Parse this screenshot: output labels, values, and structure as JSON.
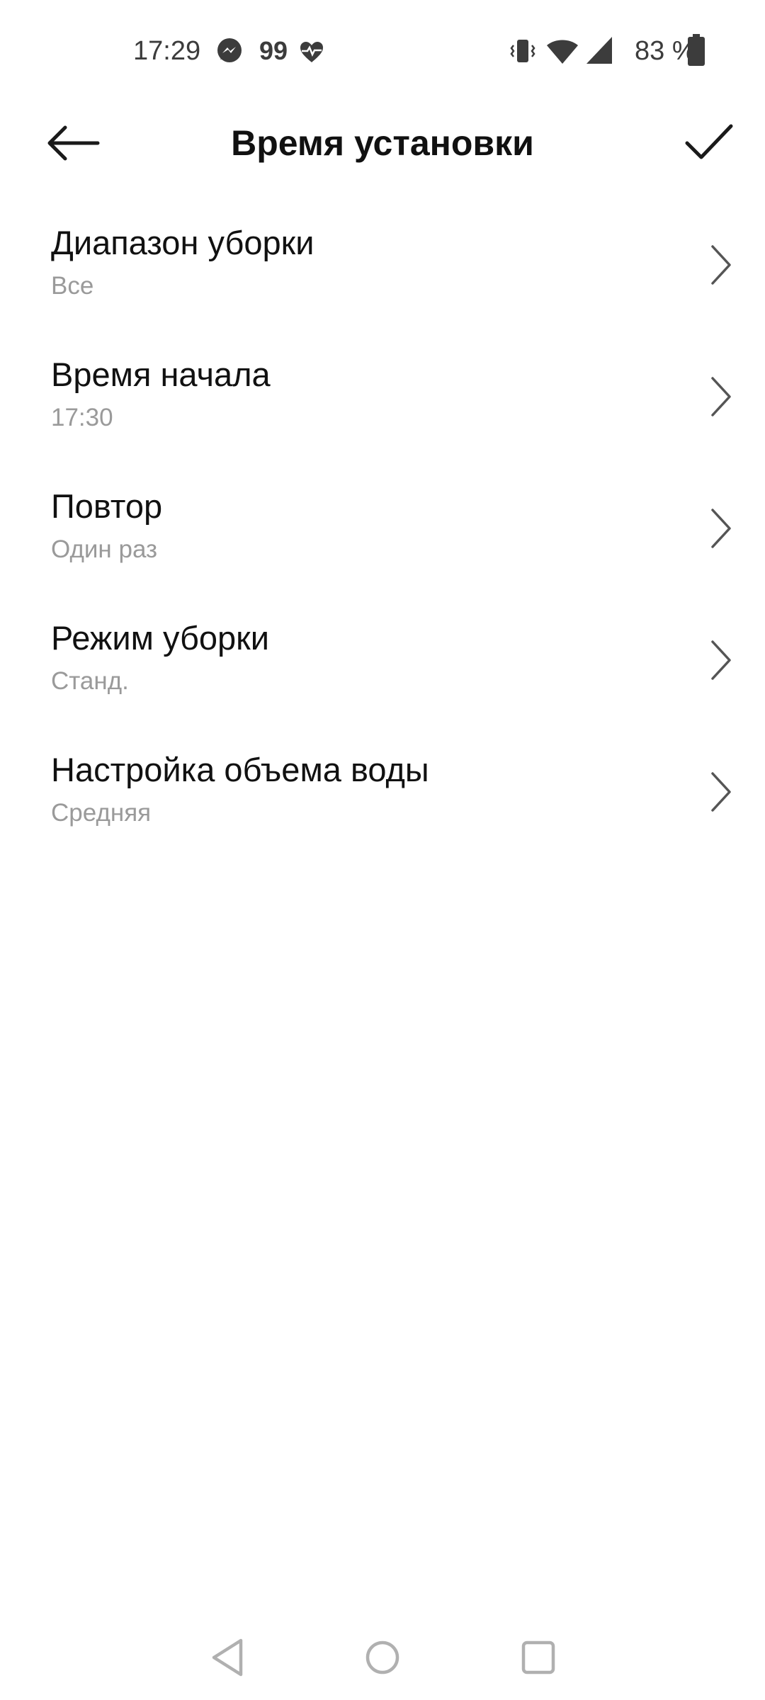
{
  "status_bar": {
    "time": "17:29",
    "notification_count": "99",
    "battery_percent": "83 %",
    "icons": [
      "messenger-icon",
      "heart-rate-icon",
      "vibrate-icon",
      "wifi-icon",
      "signal-icon",
      "battery-icon"
    ]
  },
  "header": {
    "title": "Время установки",
    "back_icon": "arrow-left-icon",
    "confirm_icon": "checkmark-icon"
  },
  "settings": [
    {
      "title": "Диапазон уборки",
      "value": "Все"
    },
    {
      "title": "Время начала",
      "value": "17:30"
    },
    {
      "title": "Повтор",
      "value": "Один раз"
    },
    {
      "title": "Режим уборки",
      "value": "Станд."
    },
    {
      "title": "Настройка объема воды",
      "value": "Средняя"
    }
  ],
  "nav_bar": {
    "icons": [
      "back-triangle-icon",
      "home-circle-icon",
      "recents-square-icon"
    ]
  },
  "colors": {
    "background": "#ffffff",
    "primary_text": "#111111",
    "secondary_text": "#9a9a9a",
    "icon": "#3c3c3c"
  }
}
